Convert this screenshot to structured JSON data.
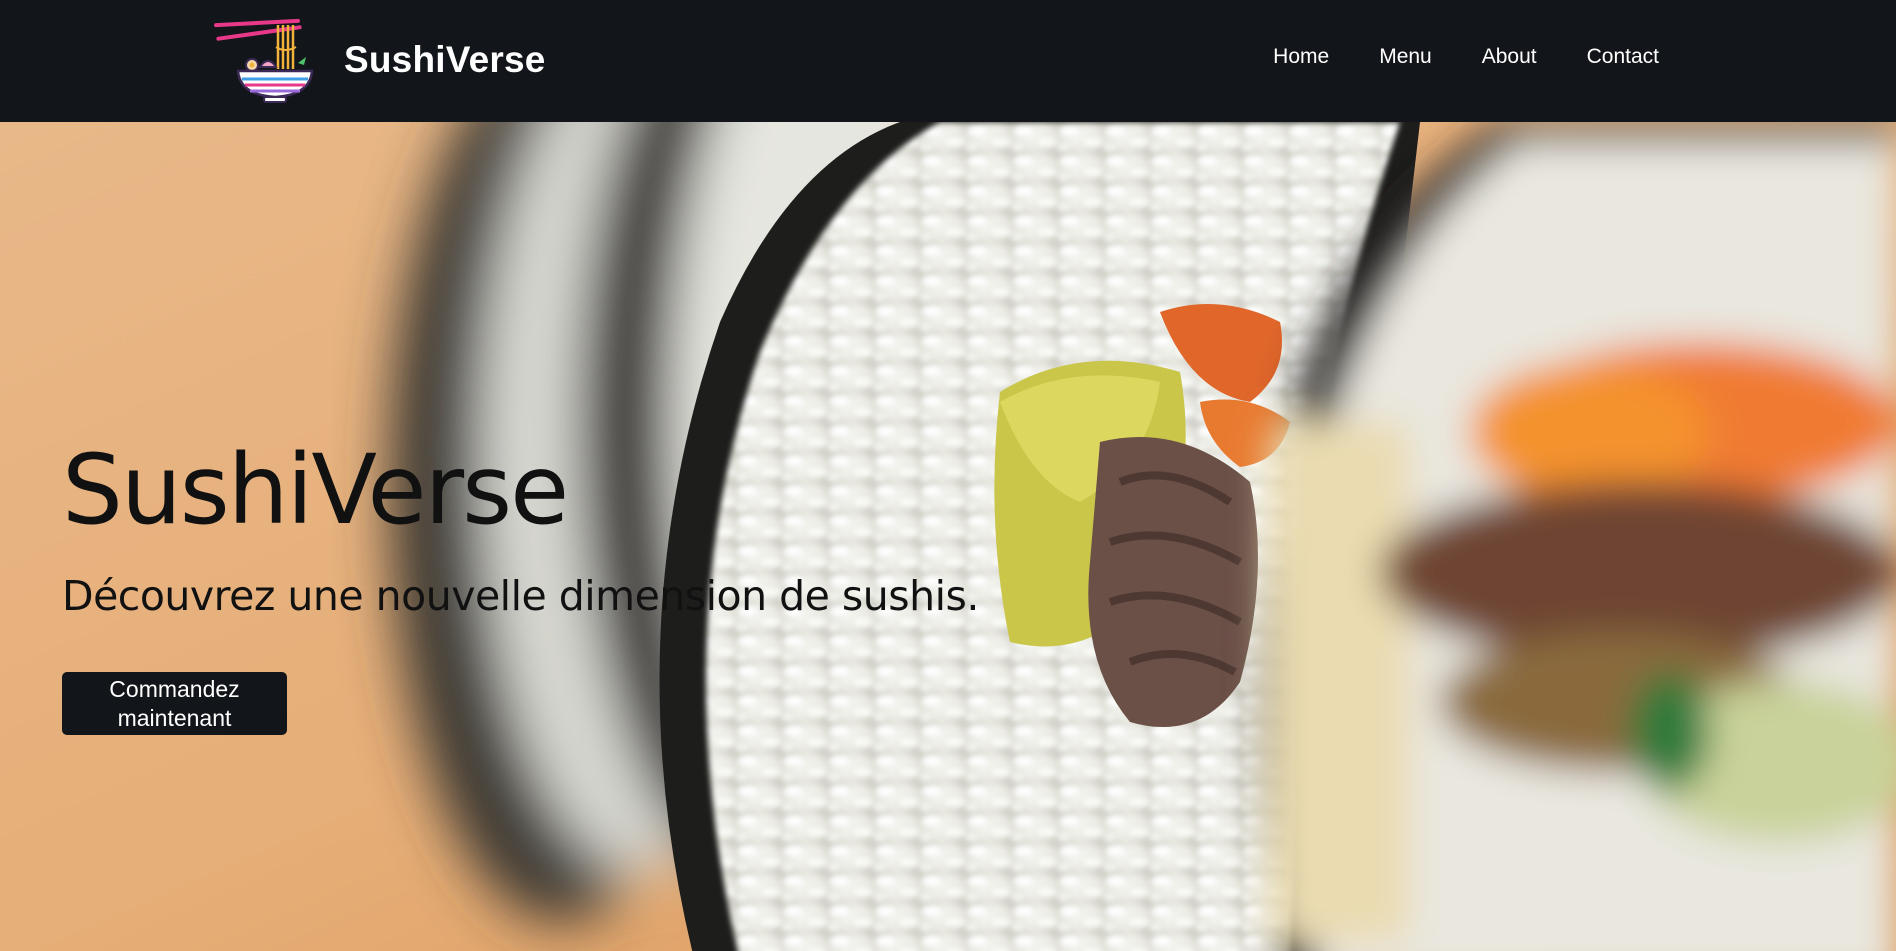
{
  "brand": {
    "name": "SushiVerse",
    "logo_icon": "ramen-bowl-chopsticks-icon"
  },
  "nav": {
    "items": [
      {
        "label": "Home"
      },
      {
        "label": "Menu"
      },
      {
        "label": "About"
      },
      {
        "label": "Contact"
      }
    ]
  },
  "hero": {
    "title": "SushiVerse",
    "subtitle": "Découvrez une nouvelle dimension de sushis.",
    "cta_label": "Commandez maintenant",
    "background_image": "sushi-roll-closeup-photo"
  },
  "colors": {
    "header_bg": "#121519",
    "button_bg": "#121519",
    "text_dark": "#111111",
    "logo_pink": "#e8388a",
    "logo_gold": "#f2b33d",
    "logo_blue": "#3fa0e8"
  }
}
